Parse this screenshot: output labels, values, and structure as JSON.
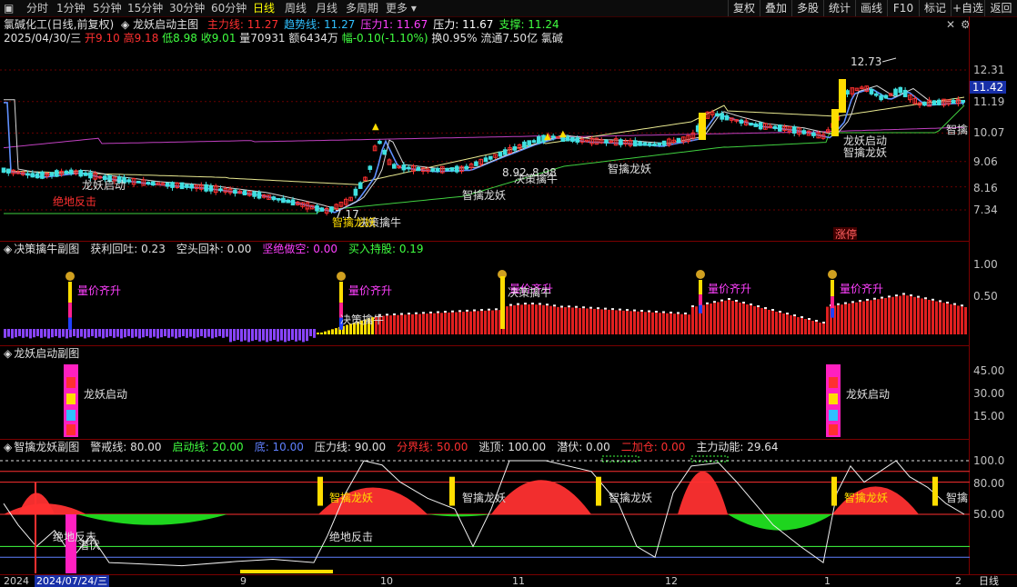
{
  "toolbar": {
    "periods": [
      "分时",
      "1分钟",
      "5分钟",
      "15分钟",
      "30分钟",
      "60分钟",
      "日线",
      "周线",
      "月线",
      "多周期",
      "更多"
    ],
    "active_period": "日线",
    "right_buttons": [
      "复权",
      "叠加",
      "多股",
      "统计",
      "画线",
      "F10",
      "标记",
      "+自选",
      "返回"
    ]
  },
  "main": {
    "stock_title": "氯碱化工(日线,前复权)",
    "indicator_name": "龙妖启动主图",
    "indicators": [
      {
        "label": "主力线: 11.27",
        "color": "#ff3030"
      },
      {
        "label": "趋势线: 11.27",
        "color": "#30c0ff"
      },
      {
        "label": "压力1: 11.67",
        "color": "#ff40ff"
      },
      {
        "label": "压力: 11.67",
        "color": "#ffffff"
      },
      {
        "label": "支撑: 11.24",
        "color": "#40ff40"
      }
    ],
    "quote": {
      "date": "2025/04/30/三",
      "open": "开9.10",
      "high": "高9.18",
      "low": "低8.98",
      "close": "收9.01",
      "vol": "量70931",
      "amount": "额6434万",
      "change": "幅-0.10(-1.10%)",
      "turnover": "换0.95%",
      "float": "流通7.50亿",
      "sector": "氯碱"
    },
    "y_ticks": [
      "12.31",
      "11.19",
      "10.07",
      "9.06",
      "8.16",
      "7.34"
    ],
    "current_price": "11.42",
    "annotations": {
      "high_mark": "12.73",
      "low_mark": "7.17",
      "mid_marks": [
        "8.92",
        "8.98"
      ],
      "longyao_qidong": "龙妖启动",
      "juedi_fanji": "绝地反击",
      "zhiqin_longyao": "智擒龙妖",
      "juece_qinniu": "决策擒牛",
      "zhiqin": "智擒",
      "zhangting": "涨停"
    }
  },
  "sub1": {
    "title": "决策擒牛副图",
    "indicators": [
      {
        "label": "获利回吐: 0.23",
        "color": "#e0e0e0"
      },
      {
        "label": "空头回补: 0.00",
        "color": "#e0e0e0"
      },
      {
        "label": "坚绝做空: 0.00",
        "color": "#ff40ff"
      },
      {
        "label": "买入持股: 0.19",
        "color": "#40ff40"
      }
    ],
    "y_ticks": [
      "1.00",
      "0.50"
    ],
    "signal_label": "量价齐升",
    "signal_label2": "决策擒牛"
  },
  "sub2": {
    "title": "龙妖启动副图",
    "y_ticks": [
      "45.00",
      "30.00",
      "15.00"
    ],
    "signal_label": "龙妖启动"
  },
  "sub3": {
    "title": "智擒龙妖副图",
    "indicators": [
      {
        "label": "警戒线: 80.00",
        "color": "#e0e0e0"
      },
      {
        "label": "启动线: 20.00",
        "color": "#40ff40"
      },
      {
        "label": "底: 10.00",
        "color": "#6080ff"
      },
      {
        "label": "压力线: 90.00",
        "color": "#e0e0e0"
      },
      {
        "label": "分界线: 50.00",
        "color": "#ff3030"
      },
      {
        "label": "逃顶: 100.00",
        "color": "#e0e0e0"
      },
      {
        "label": "潜伏: 0.00",
        "color": "#e0e0e0"
      },
      {
        "label": "二加仓: 0.00",
        "color": "#ff3030"
      },
      {
        "label": "主力动能: 29.64",
        "color": "#e0e0e0"
      }
    ],
    "y_ticks": [
      "100.0",
      "80.00",
      "50.00"
    ],
    "signal_label": "智擒龙妖",
    "signal_label2": "绝地反击",
    "signal_short": "智擒",
    "signal_latent": "潜伏"
  },
  "date_axis": {
    "labels": [
      "2024",
      "2024/07/24/三",
      "9",
      "10",
      "11",
      "12",
      "1",
      "2"
    ],
    "period": "日线"
  }
}
